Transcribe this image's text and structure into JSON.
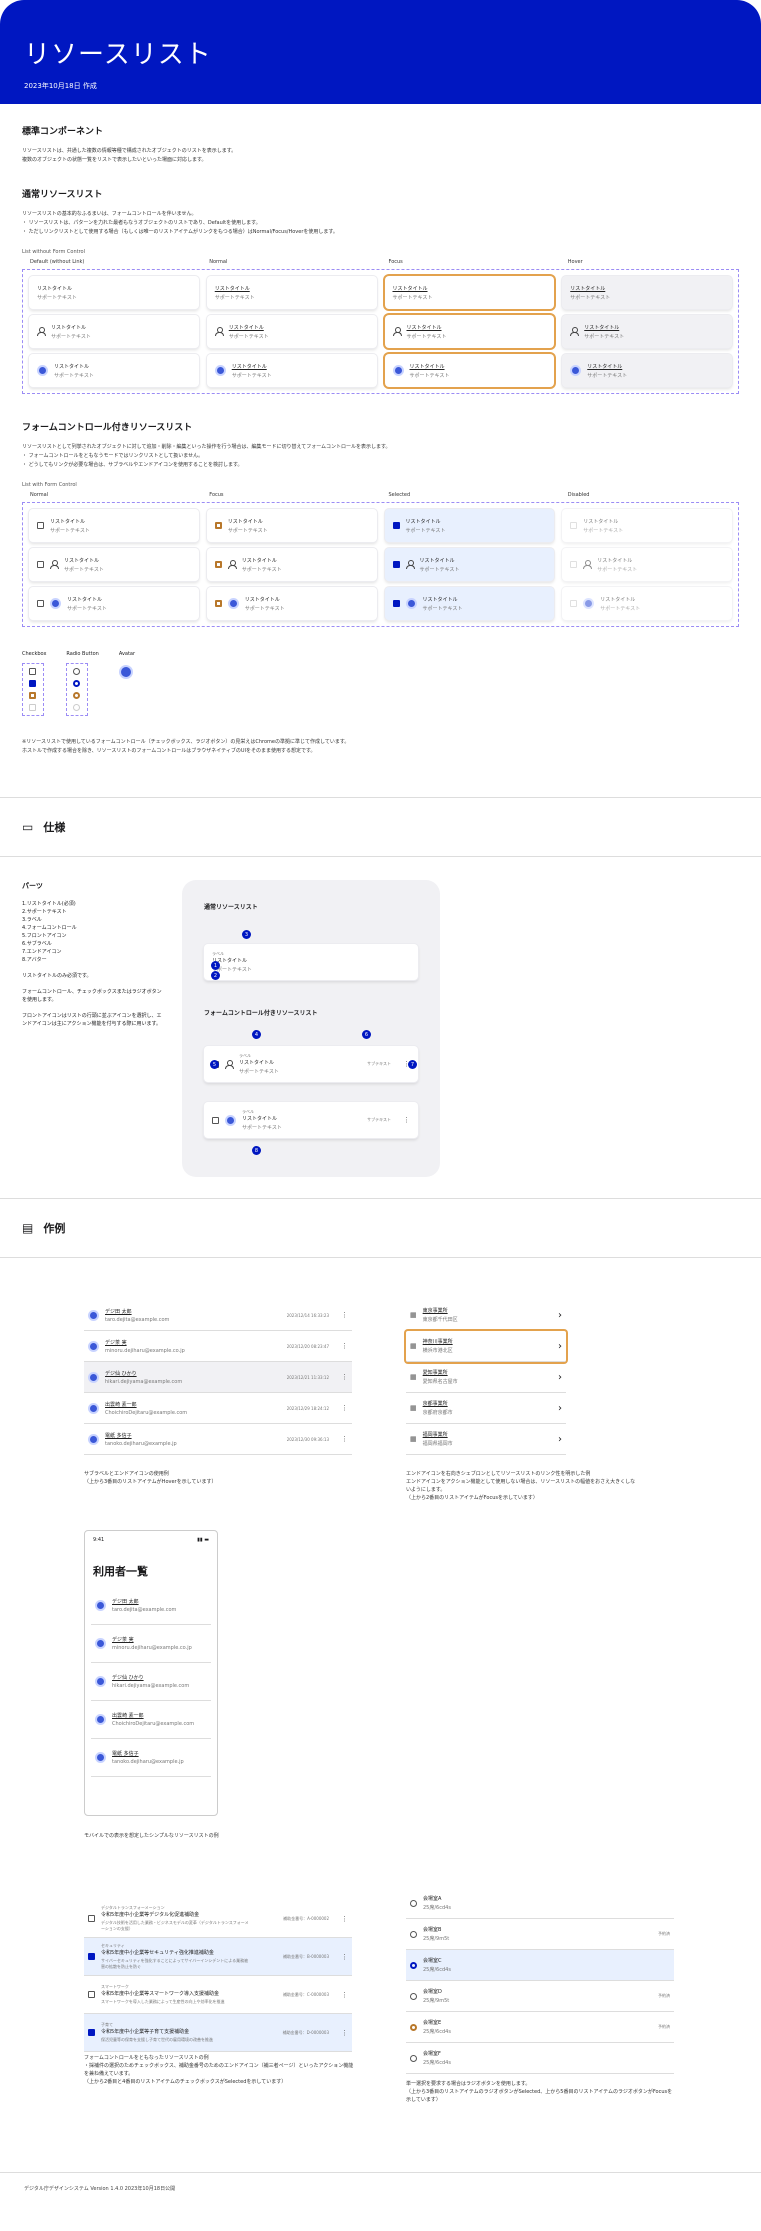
{
  "header": {
    "title": "リソースリスト",
    "date": "2023年10月18日 作成"
  },
  "std": {
    "heading": "標準コンポーネント",
    "desc1": "リソースリストは、共通した複数の情報等種で構成されたオブジェクトのリストを表示します。",
    "desc2": "複数のオブジェクトの状態一覧をリストで表示したいといった場面に対応します。"
  },
  "normal": {
    "heading": "通常リソースリスト",
    "desc1": "リソースリストの基本的なふるまいは、フォームコントロールを伴いません。",
    "desc2": "・ リソースリストは、パターンを力れた最者もなうオブジェクトのリストであり、Defaultを使用します。",
    "desc3": "・ ただしリンクリストとして使用する場合（もしくは唯一のリストアイテムがリンクをもつる場合）はNormal/Focus/Hoverを使用します。",
    "title": "List without Form Control",
    "cols": [
      "Default (without Link)",
      "Normal",
      "Focus",
      "Hover"
    ]
  },
  "item": {
    "title": "リストタイトル",
    "support": "サポートテキスト",
    "label": "ラベル",
    "subtext": "サブテキスト"
  },
  "form": {
    "heading": "フォームコントロール付きリソースリスト",
    "desc1": "リソースリストとして列挙されたオブジェクトに対して追加・削除・編集といった操作を行う場合は、編集モードに切り替えてフォームコントロールを表示します。",
    "desc2": "・ フォームコントロールをともなうモードではリンクリストとして扱いません。",
    "desc3": "・ どうしてもリンクが必要な場合は、サブラベルやエンドアイコンを使用することを検討します。",
    "title": "List with Form Control",
    "cols": [
      "Normal",
      "Focus",
      "Selected",
      "Disabled"
    ]
  },
  "controls": {
    "checkbox": "Checkbox",
    "radio": "Radio Button",
    "avatar": "Avatar",
    "note1": "※リソースリストで使用しているフォームコントロール（チェックボックス、ラジオボタン）の見栄えはChromeの準拠に準じて作成しています。",
    "note2": "ホストルで作成する場合を除き、リソースリストのフォームコントロールはブラウザネイティブのUIをそのまま使用する想定です。"
  },
  "spec": {
    "heading": "仕様",
    "parts": "パーツ",
    "list": [
      "1.リストタイトル(必須)",
      "2.サポートテキスト",
      "3.ラベル",
      "4.フォームコントロール",
      "5.フロントアイコン",
      "6.サブラベル",
      "7.エンドアイコン",
      "8.アバター"
    ],
    "n1": "リストタイトルのみ必須です。",
    "n2": "フォームコントロール、チェックボックスまたはラジオボタンを使用します。",
    "n3": "フロントアイコンはリストの行頭に並ぶアイコンを選択し、エンドアイコンは主にアクション機能を付与する際に用います。",
    "g1": "通常リソースリスト",
    "g2": "フォームコントロール付きリソースリスト"
  },
  "ex": {
    "heading": "作例",
    "users": [
      {
        "name": "デジ田 太郎",
        "mail": "taro.dejita@example.com",
        "date": "2023/12/14 16:33:23"
      },
      {
        "name": "デジ茶 実",
        "mail": "minoru.dejiharu@example.co.jp",
        "date": "2023/12/20 08:23:47"
      },
      {
        "name": "デジ仙 ひかり",
        "mail": "hikari.dejiyama@example.com",
        "date": "2023/12/21 11:33:12"
      },
      {
        "name": "出雲崎 素一郎",
        "mail": "ChoichiroDejitaru@example.com",
        "date": "2023/12/29 18:24:12"
      },
      {
        "name": "電紙 多信子",
        "mail": "tanoko.dejiharu@example.jp",
        "date": "2023/12/30 09:36:13"
      }
    ],
    "cap1a": "サブラベルとエンドアイコンの使用例",
    "cap1b": "（上から3番目のリストアイテムがHoverを示しています）",
    "orgs": [
      {
        "t": "東京事業所",
        "s": "東京都千代田区"
      },
      {
        "t": "神奈川事業所",
        "s": "横浜市港北区"
      },
      {
        "t": "愛知事業所",
        "s": "愛知県名古屋市"
      },
      {
        "t": "京都事業所",
        "s": "京都府京都市"
      },
      {
        "t": "福岡事業所",
        "s": "福岡県福岡市"
      }
    ],
    "cap2a": "エンドアイコンを右向きシェブロンとしてリソースリストのリンク性を明示した例",
    "cap2b": "エンドアイコンをアクション機能として使用しない場合は、リソースリストの幅値をおさえ大きくしないようにします。",
    "cap2c": "（上から2番目のリストアイテムがFocusを示しています）",
    "phone": {
      "time": "9:41",
      "title": "利用者一覧",
      "cap": "モバイルでの表示を想定したシンプルなリソースリストの例"
    },
    "news": [
      {
        "lab": "デジタルトランスフォーメーション",
        "t": "令和5年度中小企業等デジタル化促進補助金",
        "s": "デジタル技術を活用した業務・ビジネスモデルの変革（デジタルトランスフォーメーションの支援）",
        "no": "補助金番号：A-0000002"
      },
      {
        "lab": "セキュリティ",
        "t": "令和5年度中小企業等セキュリティ強化推進補助金",
        "s": "サイバーセキュリティを強化することによってサイバーインシデントによる業務被害の拡散を防止を防ぐ",
        "no": "補助金番号：B-0000003"
      },
      {
        "lab": "スマートワーク",
        "t": "令和5年度中小企業等スマートワーク導入支援補助金",
        "s": "スマートワークを導入した業務によって生産性の向上や効率化を推進",
        "no": "補助金番号：C-0000003"
      },
      {
        "lab": "子育て",
        "t": "令和5年度中小企業等子育て支援補助金",
        "s": "保活児童等の保育を支援し子育て世代の雇用環境の改善を推進",
        "no": "補助金番号：D-0000003"
      }
    ],
    "cap3a": "フォームコントロールをともなったリソースリストの例",
    "cap3b": "・採補件の選択のためチェックボックス、補助金番号のためのエンドアイコン（補三者ページ）といったアクション機能を兼ね備えています。",
    "cap3c": "（上から2番目と4番目のリストアイテムのチェックボックスがSelectedを示しています）",
    "rooms": [
      {
        "t": "会場室A",
        "s": "25席/6cd4s",
        "tag": ""
      },
      {
        "t": "会場室B",
        "s": "25席/9m5t",
        "tag": "予約済"
      },
      {
        "t": "会場室C",
        "s": "25席/6cd4s",
        "tag": ""
      },
      {
        "t": "会場室D",
        "s": "25席/9m5t",
        "tag": "予約済"
      },
      {
        "t": "会場室E",
        "s": "25席/6cd4s",
        "tag": "予約済"
      },
      {
        "t": "会場室F",
        "s": "25席/6cd4s",
        "tag": ""
      }
    ],
    "cap4a": "単一選択を要求する場合はラジオボタンを使用します。",
    "cap4b": "（上から3番目のリストアイテムのラジオボタンがSelected、上から5番目のリストアイテムのラジオボタンがFocusを示しています）"
  },
  "footer": "デジタル庁デザインシステム Version 1.4.0 2023年10月18日公開"
}
